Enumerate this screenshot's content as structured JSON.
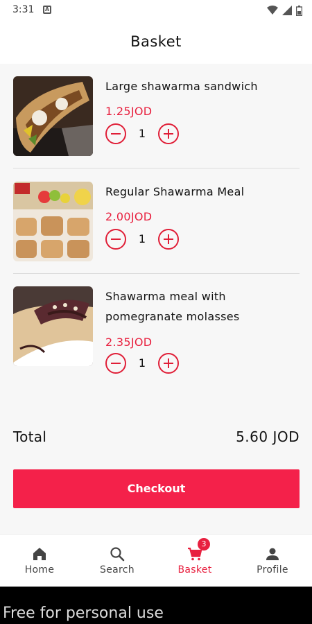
{
  "status_bar": {
    "time": "3:31",
    "notification_icon": "A"
  },
  "header": {
    "title": "Basket"
  },
  "basket": {
    "items": [
      {
        "name": "Large shawarma sandwich",
        "price": "1.25JOD",
        "quantity": "1",
        "image": "shawarma-sandwich-image"
      },
      {
        "name": "Regular Shawarma Meal",
        "price": "2.00JOD",
        "quantity": "1",
        "image": "shawarma-meal-image"
      },
      {
        "name_line1": "Shawarma meal with",
        "name_line2": "pomegranate molasses",
        "price": "2.35JOD",
        "quantity": "1",
        "image": "shawarma-molasses-image"
      }
    ],
    "total_label": "Total",
    "total_value": "5.60 JOD",
    "checkout_label": "Checkout"
  },
  "bottom_nav": {
    "items": [
      {
        "label": "Home",
        "icon": "home-icon"
      },
      {
        "label": "Search",
        "icon": "search-icon"
      },
      {
        "label": "Basket",
        "icon": "cart-icon",
        "badge": "3",
        "active": true
      },
      {
        "label": "Profile",
        "icon": "person-icon"
      }
    ]
  },
  "footer": {
    "text": "Free for personal use"
  },
  "colors": {
    "accent": "#f4214a",
    "price": "#e8203f",
    "content_bg": "#f7f7f7"
  }
}
